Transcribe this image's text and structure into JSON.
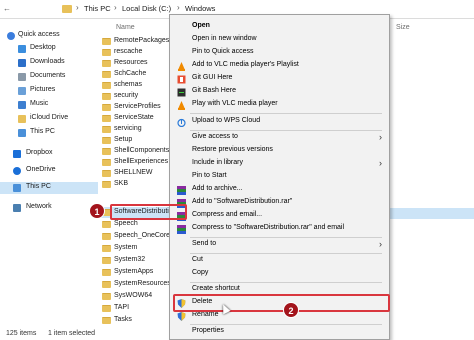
{
  "address": {
    "crumbs": [
      "This PC",
      "Local Disk (C:)",
      "Windows"
    ]
  },
  "columns": {
    "name": "Name",
    "size": "Size"
  },
  "sidebar": {
    "items": [
      {
        "label": "Quick access",
        "icon": "star-icon",
        "color": "#3b7ddd"
      },
      {
        "label": "Desktop",
        "icon": "desktop-icon",
        "color": "#3b8ede"
      },
      {
        "label": "Downloads",
        "icon": "download-icon",
        "color": "#2c6fc9"
      },
      {
        "label": "Documents",
        "icon": "document-icon",
        "color": "#8a99a8"
      },
      {
        "label": "Pictures",
        "icon": "picture-icon",
        "color": "#6aa0d8"
      },
      {
        "label": "Music",
        "icon": "music-icon",
        "color": "#3d7fd0"
      },
      {
        "label": "iCloud Drive",
        "icon": "cloud-icon",
        "color": "#e8c15a"
      },
      {
        "label": "This PC",
        "icon": "computer-icon",
        "color": "#4a90d9"
      },
      {
        "label": "Dropbox",
        "icon": "dropbox-icon",
        "color": "#1a6fd8"
      },
      {
        "label": "OneDrive",
        "icon": "onedrive-icon",
        "color": "#1a6fd8"
      },
      {
        "label": "This PC",
        "icon": "computer-icon",
        "color": "#4a90d9"
      },
      {
        "label": "Network",
        "icon": "network-icon",
        "color": "#4a7fb0"
      }
    ]
  },
  "files": [
    "RemotePackages",
    "rescache",
    "Resources",
    "SchCache",
    "schemas",
    "security",
    "ServiceProfiles",
    "ServiceState",
    "servicing",
    "Setup",
    "ShellComponents",
    "ShellExperiences",
    "SHELLNEW",
    "SKB",
    "SoftwareDistributi",
    "Speech",
    "Speech_OneCore",
    "System",
    "System32",
    "SystemApps",
    "SystemResources",
    "SysWOW64",
    "TAPI",
    "Tasks"
  ],
  "status": {
    "count": "125 items",
    "selected": "1 item selected"
  },
  "menu": {
    "items": [
      {
        "label": "Open",
        "bold": true
      },
      {
        "label": "Open in new window"
      },
      {
        "label": "Pin to Quick access"
      },
      {
        "label": "Add to VLC media player's Playlist",
        "icon": "vlc-icon"
      },
      {
        "label": "Git GUI Here",
        "icon": "git-gui-icon"
      },
      {
        "label": "Git Bash Here",
        "icon": "git-bash-icon"
      },
      {
        "label": "Play with VLC media player",
        "icon": "vlc-icon"
      },
      {
        "label": "Upload to WPS Cloud",
        "icon": "wps-cloud-icon"
      },
      {
        "label": "Give access to",
        "arrow": true
      },
      {
        "label": "Restore previous versions"
      },
      {
        "label": "Include in library",
        "arrow": true
      },
      {
        "label": "Pin to Start"
      },
      {
        "label": "Add to archive...",
        "icon": "winrar-icon"
      },
      {
        "label": "Add to \"SoftwareDistribution.rar\"",
        "icon": "winrar-icon"
      },
      {
        "label": "Compress and email...",
        "icon": "winrar-icon"
      },
      {
        "label": "Compress to \"SoftwareDistribution.rar\" and email",
        "icon": "winrar-icon"
      },
      {
        "label": "Send to",
        "arrow": true
      },
      {
        "label": "Cut"
      },
      {
        "label": "Copy"
      },
      {
        "label": "Create shortcut"
      },
      {
        "label": "Delete",
        "icon": "shield-icon"
      },
      {
        "label": "Rename",
        "icon": "shield-icon"
      },
      {
        "label": "Properties"
      }
    ]
  },
  "callouts": {
    "one": "1",
    "two": "2"
  },
  "colors": {
    "highlight": "#cce4f7",
    "callout_red": "#d9363e",
    "badge_red": "#a3141c"
  }
}
